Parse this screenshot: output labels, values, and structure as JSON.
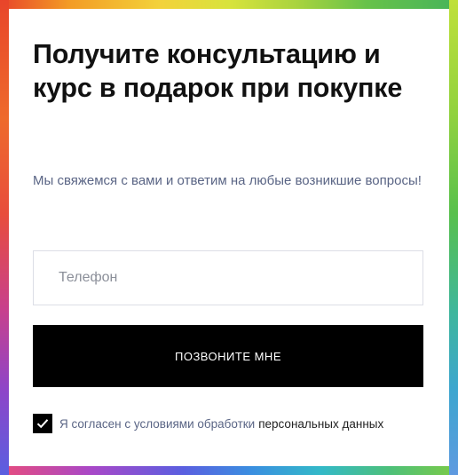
{
  "form": {
    "title": "Получите консультацию и курс в подарок при покупке",
    "subtitle": "Мы свяжемся с вами и ответим на любые возникшие вопросы!",
    "phone_placeholder": "Телефон",
    "phone_value": "",
    "submit_label": "ПОЗВОНИТЕ МНЕ",
    "consent_checked": true,
    "consent_text": "Я согласен с условиями обработки",
    "consent_link": "персональных данных"
  },
  "colors": {
    "background": "#ffffff",
    "title": "#111111",
    "subtitle": "#5a6585",
    "button": "#000000",
    "button_text": "#ffffff",
    "input_border": "#dcdee6"
  },
  "icons": {
    "checkbox": "checkmark-icon"
  }
}
